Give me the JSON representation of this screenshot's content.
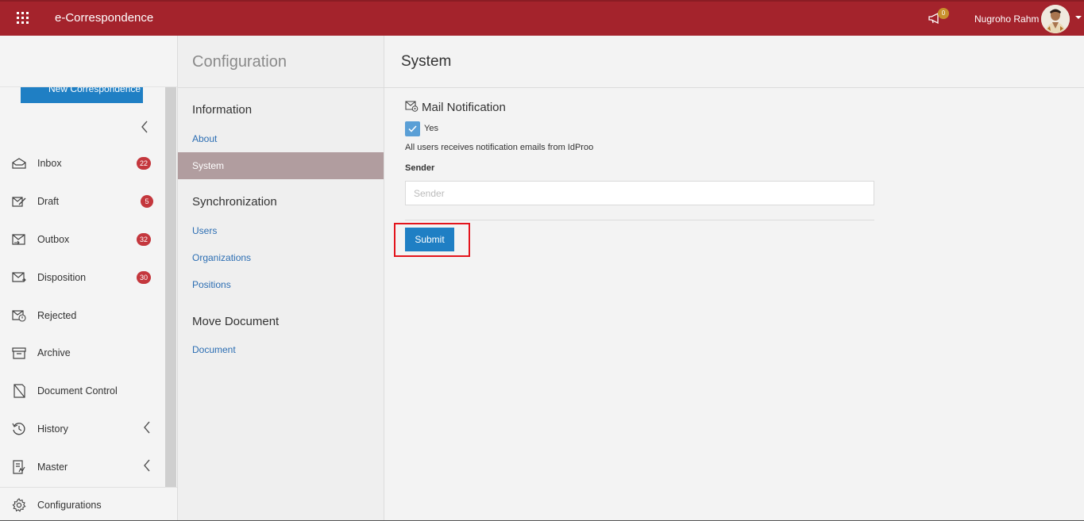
{
  "topbar": {
    "app_title": "e-Correspondence",
    "apps_icon": "grid-apps-icon",
    "notification_icon": "megaphone-icon",
    "notification_count": "0",
    "user_name": "Nugroho Rahm",
    "brand_color": "#a4232c"
  },
  "sidebar": {
    "new_button": "New Correspondence",
    "items": [
      {
        "label": "Inbox",
        "icon": "inbox-icon",
        "badge": "22"
      },
      {
        "label": "Draft",
        "icon": "draft-icon",
        "badge": "5"
      },
      {
        "label": "Outbox",
        "icon": "outbox-icon",
        "badge": "32"
      },
      {
        "label": "Disposition",
        "icon": "disposition-icon",
        "badge": "30"
      },
      {
        "label": "Rejected",
        "icon": "rejected-icon"
      },
      {
        "label": "Archive",
        "icon": "archive-icon"
      },
      {
        "label": "Document Control",
        "icon": "document-control-icon"
      },
      {
        "label": "History",
        "icon": "history-icon",
        "expandable": true
      },
      {
        "label": "Master",
        "icon": "master-icon",
        "expandable": true
      }
    ],
    "footer_label": "Configurations",
    "footer_icon": "gear-icon"
  },
  "config": {
    "title": "Configuration",
    "sections": [
      {
        "title": "Information",
        "links": [
          "About",
          "System"
        ]
      },
      {
        "title": "Synchronization",
        "links": [
          "Users",
          "Organizations",
          "Positions"
        ]
      },
      {
        "title": "Move Document",
        "links": [
          "Document"
        ]
      }
    ],
    "active_link": "System"
  },
  "main": {
    "title": "System",
    "mail_notification_title": "Mail Notification",
    "checkbox_label": "Yes",
    "checkbox_checked": true,
    "helper_text": "All users receives notification emails from IdProo",
    "sender_label": "Sender",
    "sender_placeholder": "Sender",
    "sender_value": "",
    "submit_label": "Submit",
    "accent_color": "#1f7fc4",
    "highlight_color": "#e3141c"
  }
}
